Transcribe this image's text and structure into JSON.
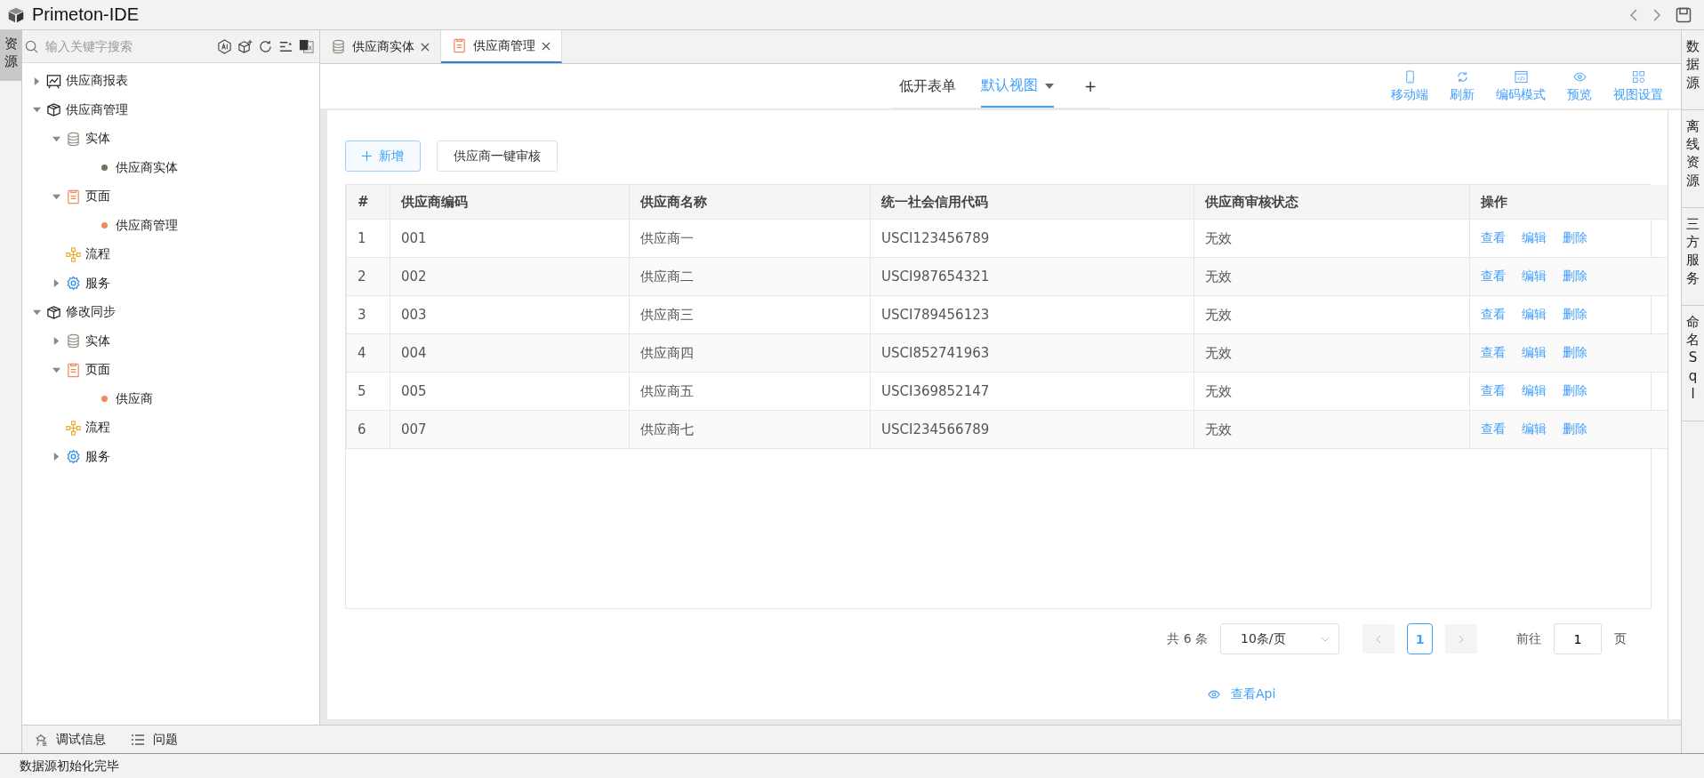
{
  "app": {
    "title": "Primeton-IDE"
  },
  "left_strip": [
    {
      "label": "资源",
      "selected": true
    }
  ],
  "search": {
    "placeholder": "输入关键字搜索"
  },
  "tree": [
    {
      "label": "供应商报表",
      "kind": "report",
      "expanded": false
    },
    {
      "label": "供应商管理",
      "kind": "module",
      "expanded": true,
      "children": [
        {
          "label": "实体",
          "kind": "entity",
          "expanded": true,
          "children": [
            {
              "label": "供应商实体",
              "kind": "dot",
              "color": "#6b7560"
            }
          ]
        },
        {
          "label": "页面",
          "kind": "page",
          "expanded": true,
          "children": [
            {
              "label": "供应商管理",
              "kind": "dot",
              "color": "#f08a5d"
            }
          ]
        },
        {
          "label": "流程",
          "kind": "flow"
        },
        {
          "label": "服务",
          "kind": "service",
          "expanded": false
        }
      ]
    },
    {
      "label": "修改同步",
      "kind": "module",
      "expanded": true,
      "children": [
        {
          "label": "实体",
          "kind": "entity",
          "expanded": false
        },
        {
          "label": "页面",
          "kind": "page",
          "expanded": true,
          "children": [
            {
              "label": "供应商",
              "kind": "dot",
              "color": "#f08a5d"
            }
          ]
        },
        {
          "label": "流程",
          "kind": "flow"
        },
        {
          "label": "服务",
          "kind": "service",
          "expanded": false
        }
      ]
    }
  ],
  "editor_tabs": [
    {
      "label": "供应商实体",
      "kind": "entity",
      "selected": false
    },
    {
      "label": "供应商管理",
      "kind": "page",
      "selected": true
    }
  ],
  "views": [
    {
      "label": "低开表单",
      "selected": false
    },
    {
      "label": "默认视图",
      "selected": true
    }
  ],
  "add_view": "+",
  "actions": [
    {
      "label": "移动端",
      "kind": "mobile"
    },
    {
      "label": "刷新",
      "kind": "refresh"
    },
    {
      "label": "编码模式",
      "kind": "code"
    },
    {
      "label": "预览",
      "kind": "preview"
    },
    {
      "label": "视图设置",
      "kind": "settings"
    }
  ],
  "buttons": [
    {
      "label": "新增",
      "kind": "primary"
    },
    {
      "label": "供应商一键审核",
      "kind": "default"
    }
  ],
  "table": {
    "columns": [
      "#",
      "供应商编码",
      "供应商名称",
      "统一社会信用代码",
      "供应商审核状态",
      "操作"
    ],
    "rows": [
      {
        "cells": [
          "1",
          "001",
          "供应商一",
          "USCI123456789",
          "无效"
        ],
        "actions": [
          "查看",
          "编辑",
          "删除"
        ]
      },
      {
        "cells": [
          "2",
          "002",
          "供应商二",
          "USCI987654321",
          "无效"
        ],
        "actions": [
          "查看",
          "编辑",
          "删除"
        ]
      },
      {
        "cells": [
          "3",
          "003",
          "供应商三",
          "USCI789456123",
          "无效"
        ],
        "actions": [
          "查看",
          "编辑",
          "删除"
        ]
      },
      {
        "cells": [
          "4",
          "004",
          "供应商四",
          "USCI852741963",
          "无效"
        ],
        "actions": [
          "查看",
          "编辑",
          "删除"
        ]
      },
      {
        "cells": [
          "5",
          "005",
          "供应商五",
          "USCI369852147",
          "无效"
        ],
        "actions": [
          "查看",
          "编辑",
          "删除"
        ]
      },
      {
        "cells": [
          "6",
          "007",
          "供应商七",
          "USCI234566789",
          "无效"
        ],
        "actions": [
          "查看",
          "编辑",
          "删除"
        ]
      }
    ]
  },
  "pagination": {
    "total": "共 6 条",
    "page_size": "10条/页",
    "pages": [
      {
        "label": "1",
        "selected": true
      }
    ],
    "goto_label": "前往",
    "goto_value": "1",
    "goto_suffix": "页"
  },
  "api_link": "查看Api",
  "right_strip": [
    "数据源",
    "离线资源",
    "三方服务",
    "命名Sql"
  ],
  "bottom_tabs": [
    {
      "label": "调试信息",
      "kind": "debug"
    },
    {
      "label": "问题",
      "kind": "problems"
    }
  ],
  "status_bar": "数据源初始化完毕"
}
